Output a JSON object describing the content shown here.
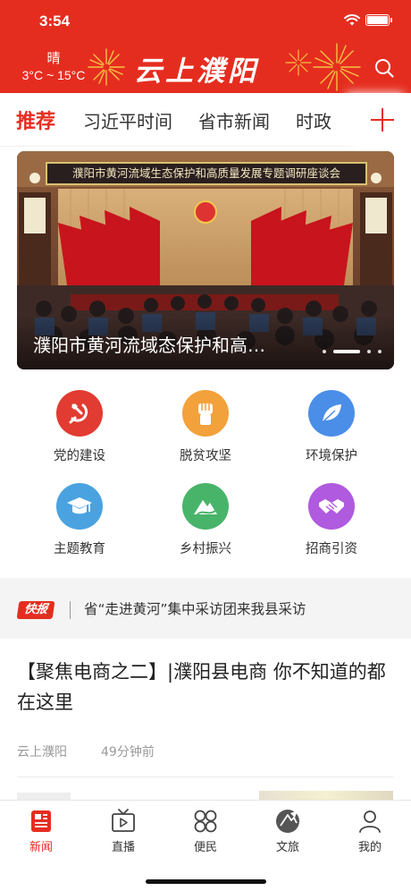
{
  "status_bar": {
    "time": "3:54"
  },
  "header": {
    "weather": {
      "condition": "晴",
      "temperature": "3°C ~ 15°C"
    },
    "logo_text": "云上濮阳",
    "colors": {
      "brand_red": "#e52d1f"
    },
    "icons": {
      "search": "search-icon"
    }
  },
  "tabs": {
    "items": [
      {
        "label": "推荐",
        "active": true
      },
      {
        "label": "习近平时间",
        "active": false
      },
      {
        "label": "省市新闻",
        "active": false
      },
      {
        "label": "时政",
        "active": false
      }
    ],
    "add_icon": "plus-icon"
  },
  "banner": {
    "headline_sign": "濮阳市黄河流域生态保护和高质量发展专题调研座谈会",
    "title": "濮阳市黄河流域态保护和高…",
    "active_dot": 1,
    "dot_count": 4
  },
  "shortcuts": [
    {
      "label": "党的建设",
      "icon": "hammer-sickle-icon",
      "color": "#e23b31"
    },
    {
      "label": "脱贫攻坚",
      "icon": "fist-icon",
      "color": "#f3a13a"
    },
    {
      "label": "环境保护",
      "icon": "leaf-icon",
      "color": "#4a8ee8"
    },
    {
      "label": "主题教育",
      "icon": "graduation-cap-icon",
      "color": "#4aa3e0"
    },
    {
      "label": "乡村振兴",
      "icon": "mountain-icon",
      "color": "#48b46a"
    },
    {
      "label": "招商引资",
      "icon": "handshake-icon",
      "color": "#b05ae0"
    }
  ],
  "flash": {
    "tag": "快报",
    "text": "省“走进黄河”集中采访团来我县采访"
  },
  "article": {
    "title": "【聚焦电商之二】|濮阳县电商 你不知道的都在这里",
    "source": "云上濮阳",
    "time": "49分钟前"
  },
  "tabbar": [
    {
      "label": "新闻",
      "icon": "news-icon",
      "active": true
    },
    {
      "label": "直播",
      "icon": "tv-icon",
      "active": false
    },
    {
      "label": "便民",
      "icon": "grid-icon",
      "active": false
    },
    {
      "label": "文旅",
      "icon": "travel-icon",
      "active": false
    },
    {
      "label": "我的",
      "icon": "user-icon",
      "active": false
    }
  ]
}
